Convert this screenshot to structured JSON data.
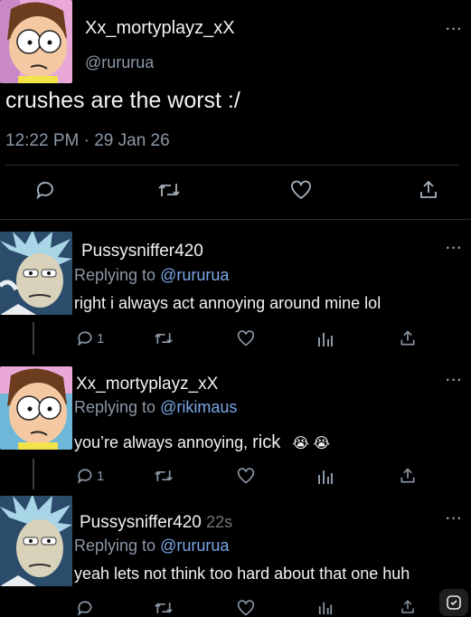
{
  "main_tweet": {
    "display_name": "Xx_mortyplayz_xX",
    "handle": "@rururua",
    "text": "crushes are the worst :/",
    "timestamp": "12:22 PM · 29 Jan 26",
    "avatar_icon": "morty-avatar"
  },
  "replies": [
    {
      "display_name": "Pussysniffer420",
      "time": "",
      "replying_prefix": "Replying to",
      "replying_handle": "@rururua",
      "text": "right i always act annoying around mine lol",
      "reply_count": "1",
      "avatar_icon": "rick-avatar"
    },
    {
      "display_name": "Xx_mortyplayz_xX",
      "time": "",
      "replying_prefix": "Replying to",
      "replying_handle": "@rikimaus",
      "text": "you’re always annoying,",
      "text_tail": "rick",
      "emoji": "😭 😭",
      "reply_count": "1",
      "avatar_icon": "morty-avatar"
    },
    {
      "display_name": "Pussysniffer420",
      "time": "22s",
      "replying_prefix": "Replying to",
      "replying_handle": "@rururua",
      "text": "yeah lets not think too hard about that one huh",
      "reply_count": "",
      "avatar_icon": "rick-avatar"
    }
  ],
  "more_label": "···",
  "colors": {
    "background": "#000000",
    "text": "#f2f2f2",
    "secondary": "#8b98a5",
    "link": "#7aa6e8"
  }
}
